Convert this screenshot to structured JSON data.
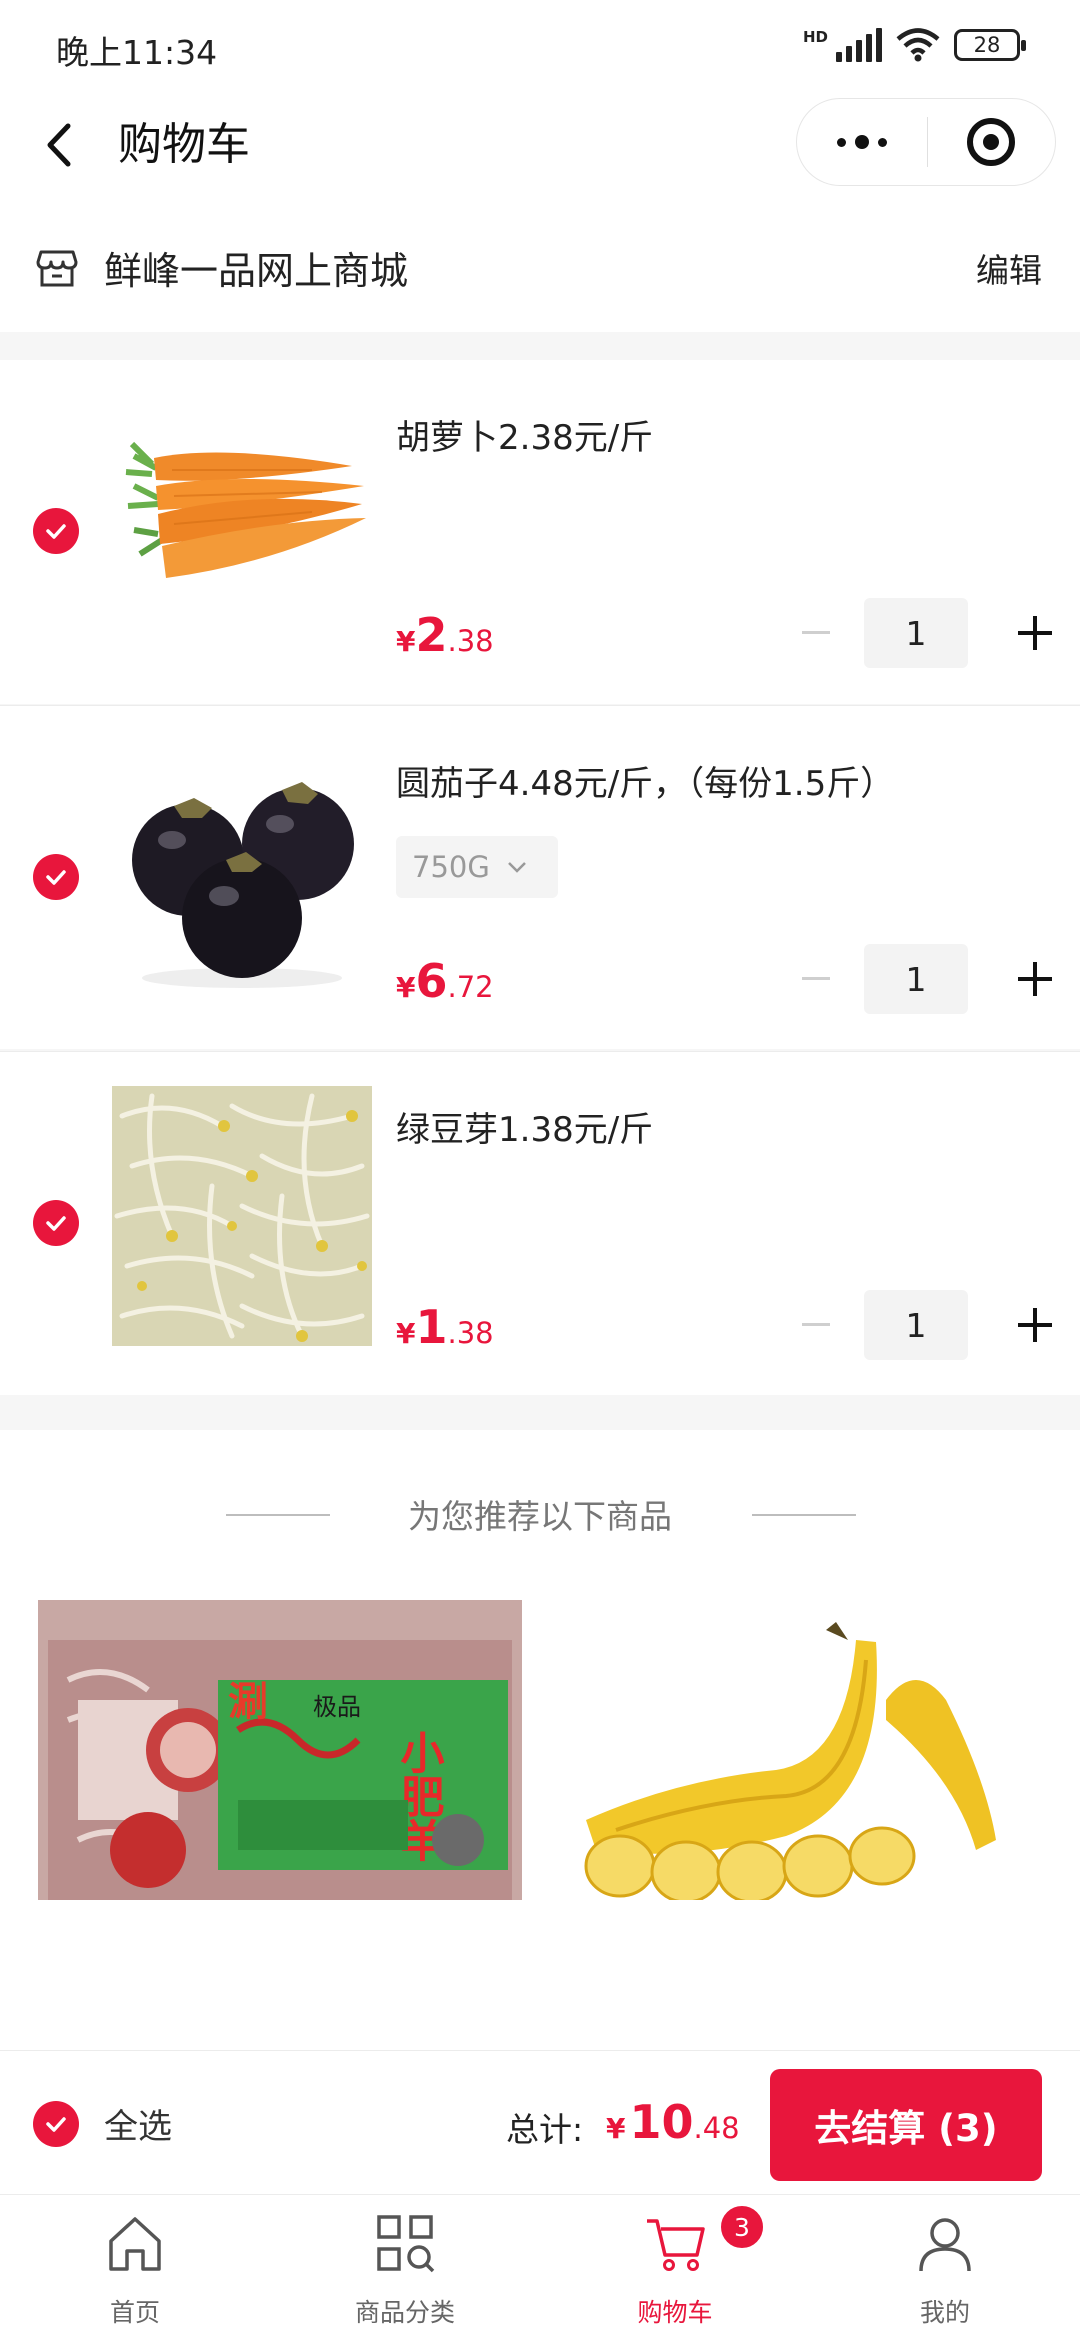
{
  "status_bar": {
    "time": "晚上11:34",
    "network": "HD",
    "battery": "28"
  },
  "nav": {
    "title": "购物车"
  },
  "store": {
    "name": "鲜峰一品网上商城",
    "edit_label": "编辑"
  },
  "cart_items": [
    {
      "title": "胡萝卜2.38元/斤",
      "currency": "¥",
      "price_int": "2",
      "price_dec": ".38",
      "quantity": "1",
      "checked": true,
      "image": "carrot"
    },
    {
      "title": "圆茄子4.48元/斤，（每份1.5斤）",
      "spec": "750G",
      "currency": "¥",
      "price_int": "6",
      "price_dec": ".72",
      "quantity": "1",
      "checked": true,
      "image": "eggplant"
    },
    {
      "title": "绿豆芽1.38元/斤",
      "currency": "¥",
      "price_int": "1",
      "price_dec": ".38",
      "quantity": "1",
      "checked": true,
      "image": "bean-sprouts"
    }
  ],
  "recommend": {
    "title": "为您推荐以下商品",
    "products": [
      {
        "image": "lamb-slices-package",
        "package_text": [
          "涮",
          "极品",
          "小肥羊"
        ]
      },
      {
        "image": "banana"
      }
    ]
  },
  "checkout": {
    "select_all_label": "全选",
    "total_label": "总计:",
    "currency": "¥",
    "total_int": "10",
    "total_dec": ".48",
    "button_label": "去结算 (3)"
  },
  "tabs": [
    {
      "label": "首页",
      "icon": "home-icon"
    },
    {
      "label": "商品分类",
      "icon": "category-grid-icon"
    },
    {
      "label": "购物车",
      "icon": "cart-icon",
      "badge": "3",
      "active": true
    },
    {
      "label": "我的",
      "icon": "user-icon"
    }
  ],
  "colors": {
    "accent": "#e8163c",
    "background": "#f6f6f6"
  }
}
